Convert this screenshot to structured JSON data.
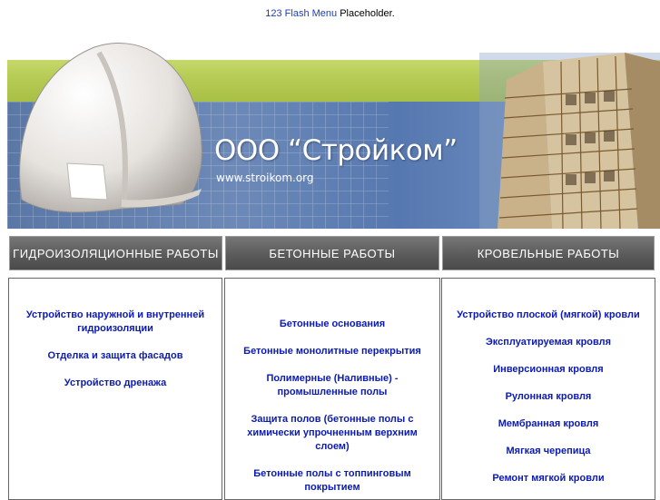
{
  "header": {
    "flash_link": "123 Flash Menu",
    "flash_text": " Placeholder."
  },
  "banner": {
    "company": "ООО “Стройком”",
    "site": "www.stroikom.org"
  },
  "nav": [
    {
      "label": "ГИДРОИЗОЛЯЦИОННЫЕ РАБОТЫ"
    },
    {
      "label": "БЕТОННЫЕ РАБОТЫ"
    },
    {
      "label": "КРОВЕЛЬНЫЕ РАБОТЫ"
    }
  ],
  "columns": [
    {
      "links": [
        {
          "label": "Устройство наружной и внутренней гидроизоляции"
        },
        {
          "label": "Отделка и защита фасадов"
        },
        {
          "label": "Устройство дренажа"
        }
      ]
    },
    {
      "links": [
        {
          "label": "Бетонные основания"
        },
        {
          "label": "Бетонные монолитные перекрытия"
        },
        {
          "label": "Полимерные (Наливные) - промышленные полы"
        },
        {
          "label": "Защита полов (бетонные полы с химически упрочненным верхним слоем)"
        },
        {
          "label": "Бетонные полы с топпинговым покрытием"
        }
      ]
    },
    {
      "links": [
        {
          "label": "Устройство плоской (мягкой) кровли"
        },
        {
          "label": "Эксплуатируемая кровля"
        },
        {
          "label": "Инверсионная кровля"
        },
        {
          "label": "Рулонная кровля"
        },
        {
          "label": "Мембранная кровля"
        },
        {
          "label": "Мягкая черепица"
        },
        {
          "label": "Ремонт мягкой кровли"
        }
      ]
    }
  ]
}
